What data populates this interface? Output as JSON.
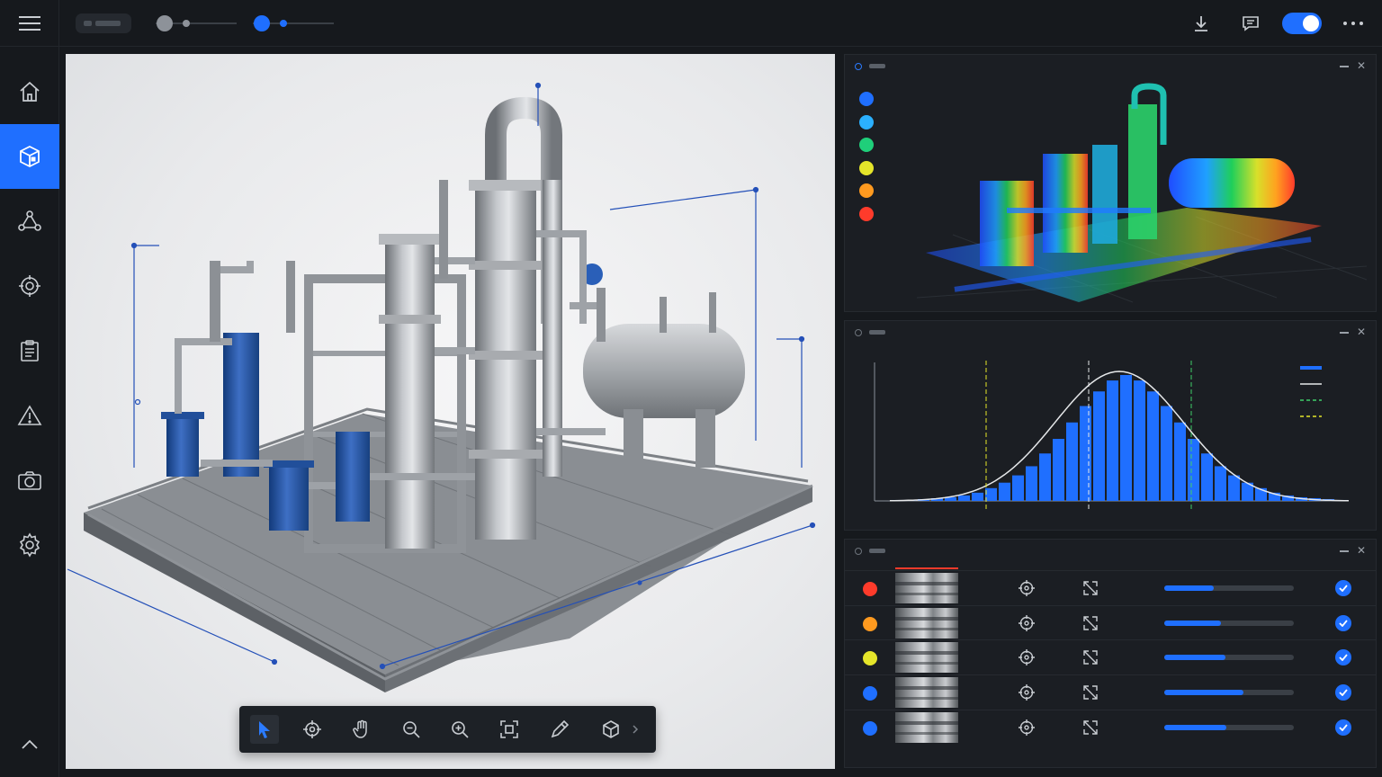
{
  "colors": {
    "accent": "#1f6fff",
    "background": "#16191d",
    "panel": "#1b1e23"
  },
  "topbar": {
    "menu_icon": "hamburger-menu-icon",
    "sliders": [
      {
        "name": "gray-slider",
        "color": "#8d9299"
      },
      {
        "name": "blue-slider",
        "color": "#1f6fff"
      }
    ],
    "actions": [
      {
        "name": "download-icon"
      },
      {
        "name": "comment-icon"
      },
      {
        "name": "view-toggle",
        "on": true
      },
      {
        "name": "more-options-icon"
      }
    ]
  },
  "sidebar": {
    "items": [
      {
        "name": "home-icon",
        "active": false
      },
      {
        "name": "model-cube-icon",
        "active": true
      },
      {
        "name": "network-icon",
        "active": false
      },
      {
        "name": "target-icon",
        "active": false
      },
      {
        "name": "clipboard-icon",
        "active": false
      },
      {
        "name": "warning-icon",
        "active": false
      },
      {
        "name": "camera-icon",
        "active": false
      },
      {
        "name": "settings-gear-icon",
        "active": false
      }
    ],
    "collapse_icon": "chevron-up-icon"
  },
  "toolbar": {
    "tools": [
      {
        "name": "select-pointer-icon",
        "active": true
      },
      {
        "name": "crosshair-target-icon",
        "active": false
      },
      {
        "name": "pan-hand-icon",
        "active": false
      },
      {
        "name": "zoom-out-icon",
        "active": false
      },
      {
        "name": "zoom-in-icon",
        "active": false
      },
      {
        "name": "fit-frame-icon",
        "active": false
      },
      {
        "name": "measure-pencil-icon",
        "active": false
      },
      {
        "name": "cube-view-icon",
        "active": false
      }
    ],
    "more_icon": "chevron-right-icon"
  },
  "heatmap_panel": {
    "legend_colors": [
      "#1f6fff",
      "#2bb0ff",
      "#1fcf7a",
      "#e5e52a",
      "#ff9a1f",
      "#ff3b2b"
    ]
  },
  "histogram_panel": {
    "bins": [
      1,
      1,
      2,
      3,
      4,
      6,
      9,
      14,
      20,
      28,
      38,
      52,
      68,
      86,
      104,
      120,
      132,
      138,
      132,
      120,
      104,
      86,
      68,
      52,
      38,
      28,
      20,
      14,
      9,
      6,
      4,
      3,
      2,
      1
    ],
    "legend": [
      {
        "style": "solid-bar",
        "color": "#1f6fff"
      },
      {
        "style": "solid-line",
        "color": "#e6e8ea"
      },
      {
        "style": "dashed-line",
        "color": "#3fcf6a"
      },
      {
        "style": "dashed-line",
        "color": "#e5e52a"
      }
    ]
  },
  "inspection_panel": {
    "rows": [
      {
        "status_color": "#ff3b2b",
        "progress": 0.38
      },
      {
        "status_color": "#ff9a1f",
        "progress": 0.44
      },
      {
        "status_color": "#e5e52a",
        "progress": 0.47
      },
      {
        "status_color": "#1f6fff",
        "progress": 0.61
      },
      {
        "status_color": "#1f6fff",
        "progress": 0.48
      }
    ]
  }
}
